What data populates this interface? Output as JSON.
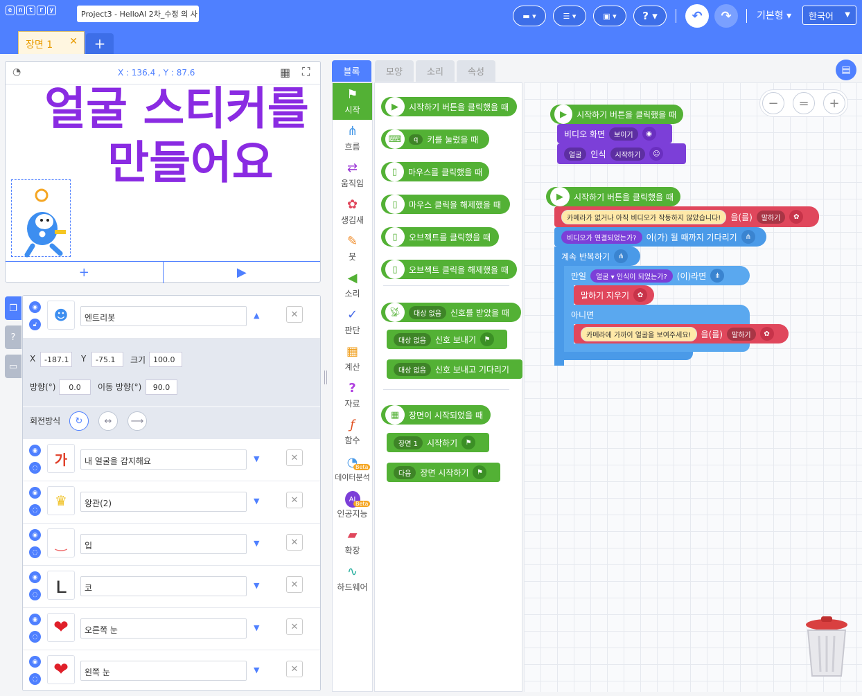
{
  "app": {
    "logo_letters": [
      "e",
      "n",
      "t",
      "r",
      "y"
    ],
    "project_name": "Project3 - HelloAI 2차_수정 의 사",
    "mode": "기본형",
    "language": "한국어"
  },
  "scene": {
    "tab_label": "장면 1",
    "close": "✕",
    "add": "+"
  },
  "stage": {
    "coordinates": "X : 136.4 , Y : 87.6",
    "title_line1": "얼굴 스티커를",
    "title_line2": "만들어요",
    "add": "+",
    "play": "▶"
  },
  "object": {
    "name": "엔트리봇",
    "x_label": "X",
    "x": "-187.1",
    "y_label": "Y",
    "y": "-75.1",
    "size_label": "크기",
    "size": "100.0",
    "dir_label": "방향(°)",
    "dir": "0.0",
    "move_dir_label": "이동 방향(°)",
    "move_dir": "90.0",
    "rotation_label": "회전방식"
  },
  "objects": [
    {
      "name": "내 얼굴을 감지해요",
      "thumb": "가"
    },
    {
      "name": "왕관(2)",
      "thumb": "♛"
    },
    {
      "name": "입",
      "thumb": "‿"
    },
    {
      "name": "코",
      "thumb": "ʟ"
    },
    {
      "name": "오른쪽 눈",
      "thumb": "❤"
    },
    {
      "name": "왼쪽 눈",
      "thumb": "❤"
    }
  ],
  "block_tabs": [
    "블록",
    "모양",
    "소리",
    "속성"
  ],
  "categories": [
    {
      "label": "시작",
      "icon": "⚑"
    },
    {
      "label": "흐름",
      "icon": "⋔"
    },
    {
      "label": "움직임",
      "icon": "⇄"
    },
    {
      "label": "생김새",
      "icon": "✿"
    },
    {
      "label": "붓",
      "icon": "✎"
    },
    {
      "label": "소리",
      "icon": "◀"
    },
    {
      "label": "판단",
      "icon": "✓"
    },
    {
      "label": "계산",
      "icon": "▦"
    },
    {
      "label": "자료",
      "icon": "?"
    },
    {
      "label": "함수",
      "icon": "ƒ"
    },
    {
      "label": "데이터분석",
      "icon": "◔",
      "badge": "Beta"
    },
    {
      "label": "인공지능",
      "icon": "AI",
      "badge": "Beta"
    },
    {
      "label": "확장",
      "icon": "▰"
    },
    {
      "label": "하드웨어",
      "icon": "∿"
    }
  ],
  "palette": {
    "b1": "시작하기 버튼을 클릭했을 때",
    "b2_key": "q",
    "b2": "키를 눌렀을 때",
    "b3": "마우스를 클릭했을 때",
    "b4": "마우스 클릭을 해제했을 때",
    "b5": "오브젝트를 클릭했을 때",
    "b6": "오브젝트 클릭을 해제했을 때",
    "b7_dd": "대상 없음",
    "b7": "신호를 받았을 때",
    "b8_dd": "대상 없음",
    "b8": "신호 보내기",
    "b9_dd": "대상 없음",
    "b9": "신호 보내고 기다리기",
    "b10": "장면이 시작되었을 때",
    "b11_dd": "장면 1",
    "b11": "시작하기",
    "b12_dd": "다음",
    "b12": "장면 시작하기"
  },
  "script1": {
    "hat": "시작하기 버튼을 클릭했을 때",
    "video": "비디오 화면",
    "video_dd": "보이기",
    "face_dd": "얼굴",
    "recog": "인식",
    "start_dd": "시작하기"
  },
  "script2": {
    "hat": "시작하기 버튼을 클릭했을 때",
    "msg": "카메라가 없거나 아직 비디오가 작동하지 않았습니다!",
    "eul": "을(를)",
    "say_dd": "말하기",
    "connected": "비디오가 연결되었는가?",
    "wait": "이(가) 될 때까지 기다리기",
    "loop": "계속 반복하기",
    "if": "만일",
    "face_dd": "얼굴",
    "recognized": "인식이 되었는가?",
    "then": "(이)라면",
    "clear": "말하기 지우기",
    "else": "아니면",
    "msg2": "카메라에 가까이 얼굴을 보여주세요!",
    "eul2": "을(를)",
    "say_dd2": "말하기"
  },
  "zoom": {
    "out": "−",
    "reset": "=",
    "in": "+"
  }
}
